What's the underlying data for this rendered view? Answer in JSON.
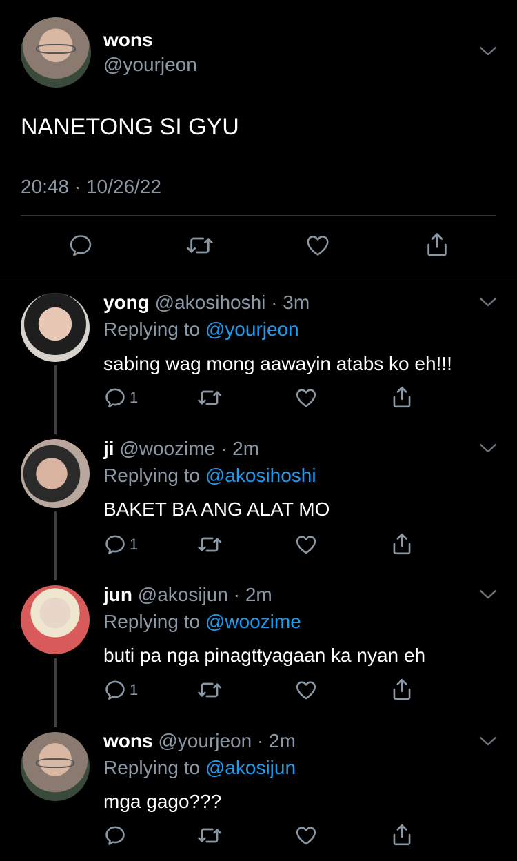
{
  "tweet": {
    "name": "wons",
    "handle": "@yourjeon",
    "text": "NANETONG SI GYU",
    "timestamp": "20:48 · 10/26/22"
  },
  "replies": [
    {
      "name": "yong",
      "handle_time": "@akosihoshi · 3m",
      "replying_prefix": "Replying to",
      "replying_to": "@yourjeon",
      "text": "sabing wag mong aawayin atabs ko eh!!!",
      "reply_count": "1"
    },
    {
      "name": "ji",
      "handle_time": "@woozime · 2m",
      "replying_prefix": "Replying to",
      "replying_to": "@akosihoshi",
      "text": "BAKET BA ANG ALAT MO",
      "reply_count": "1"
    },
    {
      "name": "jun",
      "handle_time": "@akosijun · 2m",
      "replying_prefix": "Replying to",
      "replying_to": "@woozime",
      "text": "buti pa nga pinagttyagaan ka nyan eh",
      "reply_count": "1"
    },
    {
      "name": "wons",
      "handle_time": "@yourjeon · 2m",
      "replying_prefix": "Replying to",
      "replying_to": "@akosijun",
      "text": "mga gago???",
      "reply_count": ""
    }
  ],
  "icons": {
    "reply": "reply-icon",
    "retweet": "retweet-icon",
    "like": "heart-icon",
    "share": "share-icon",
    "more": "chevron-down-icon"
  },
  "colors": {
    "background": "#000000",
    "text": "#ffffff",
    "muted": "#8b98a5",
    "link": "#1d9bf0",
    "divider": "#2f3336"
  }
}
